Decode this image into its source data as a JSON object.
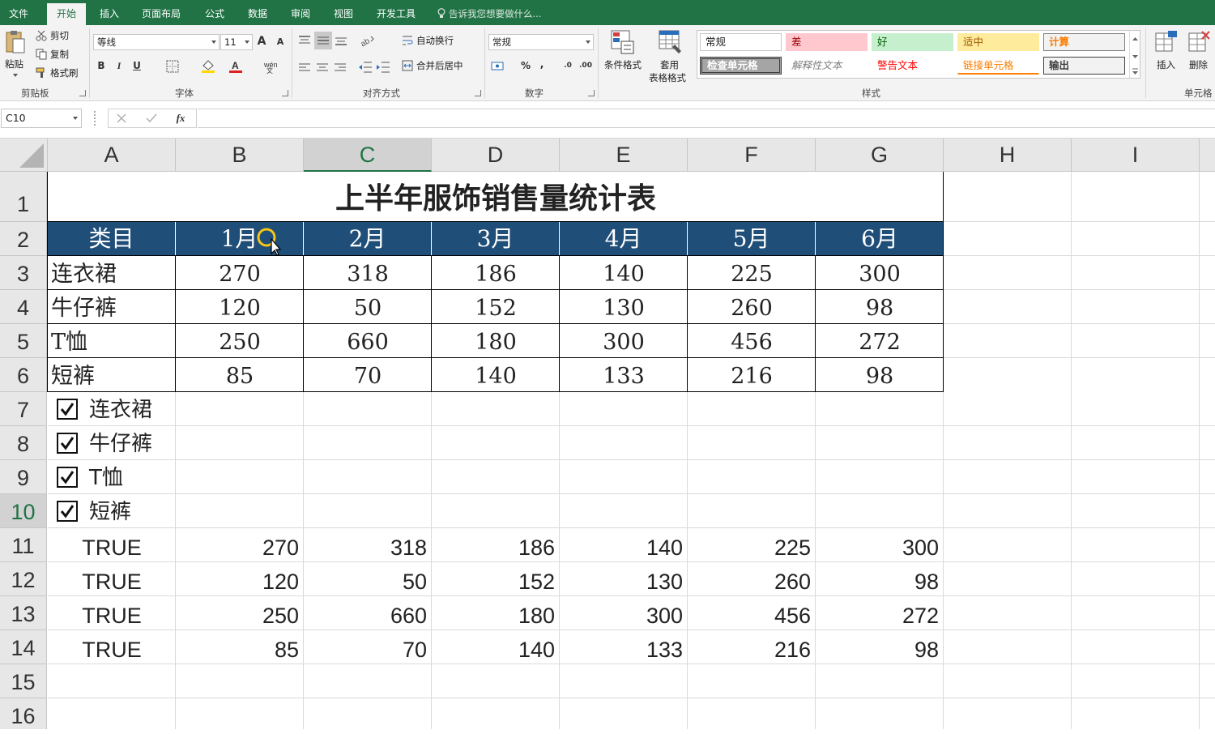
{
  "menu": {
    "tabs": [
      "文件",
      "开始",
      "插入",
      "页面布局",
      "公式",
      "数据",
      "审阅",
      "视图",
      "开发工具"
    ],
    "active": "开始",
    "tell_me": "告诉我您想要做什么..."
  },
  "ribbon": {
    "clipboard": {
      "paste": "粘贴",
      "cut": "剪切",
      "copy": "复制",
      "format_painter": "格式刷",
      "label": "剪贴板"
    },
    "font": {
      "name": "等线",
      "size": "11",
      "bold": "B",
      "italic": "I",
      "underline": "U",
      "label": "字体"
    },
    "alignment": {
      "wrap": "自动换行",
      "merge": "合并后居中",
      "label": "对齐方式"
    },
    "number": {
      "format": "常规",
      "label": "数字"
    },
    "styles": {
      "conditional": "条件格式",
      "table_format": "套用\n表格格式",
      "table_format_l1": "套用",
      "table_format_l2": "表格格式",
      "cells": [
        "常规",
        "差",
        "好",
        "适中",
        "计算",
        "检查单元格",
        "解释性文本",
        "警告文本",
        "链接单元格",
        "输出"
      ],
      "label": "样式"
    },
    "cells": {
      "insert": "插入",
      "delete": "删除",
      "label": "单元格"
    }
  },
  "formula_bar": {
    "name_box": "C10",
    "formula": ""
  },
  "columns": [
    "A",
    "B",
    "C",
    "D",
    "E",
    "F",
    "G",
    "H",
    "I"
  ],
  "rows": [
    "1",
    "2",
    "3",
    "4",
    "5",
    "6",
    "7",
    "8",
    "9",
    "10",
    "11",
    "12",
    "13",
    "14",
    "15",
    "16"
  ],
  "selected": {
    "column": "C",
    "row": "10"
  },
  "sheet": {
    "title": "上半年服饰销售量统计表",
    "header": [
      "类目",
      "1月",
      "2月",
      "3月",
      "4月",
      "5月",
      "6月"
    ],
    "data": [
      [
        "连衣裙",
        "270",
        "318",
        "186",
        "140",
        "225",
        "300"
      ],
      [
        "牛仔裤",
        "120",
        "50",
        "152",
        "130",
        "260",
        "98"
      ],
      [
        "T恤",
        "250",
        "660",
        "180",
        "300",
        "456",
        "272"
      ],
      [
        "短裤",
        "85",
        "70",
        "140",
        "133",
        "216",
        "98"
      ]
    ],
    "checkboxes": [
      {
        "label": "连衣裙",
        "checked": true
      },
      {
        "label": "牛仔裤",
        "checked": true
      },
      {
        "label": "T恤",
        "checked": true
      },
      {
        "label": "短裤",
        "checked": true
      }
    ],
    "linked": [
      [
        "TRUE",
        "270",
        "318",
        "186",
        "140",
        "225",
        "300"
      ],
      [
        "TRUE",
        "120",
        "50",
        "152",
        "130",
        "260",
        "98"
      ],
      [
        "TRUE",
        "250",
        "660",
        "180",
        "300",
        "456",
        "272"
      ],
      [
        "TRUE",
        "85",
        "70",
        "140",
        "133",
        "216",
        "98"
      ]
    ]
  },
  "colors": {
    "accent": "#217346",
    "header_fill": "#1f4e79"
  }
}
